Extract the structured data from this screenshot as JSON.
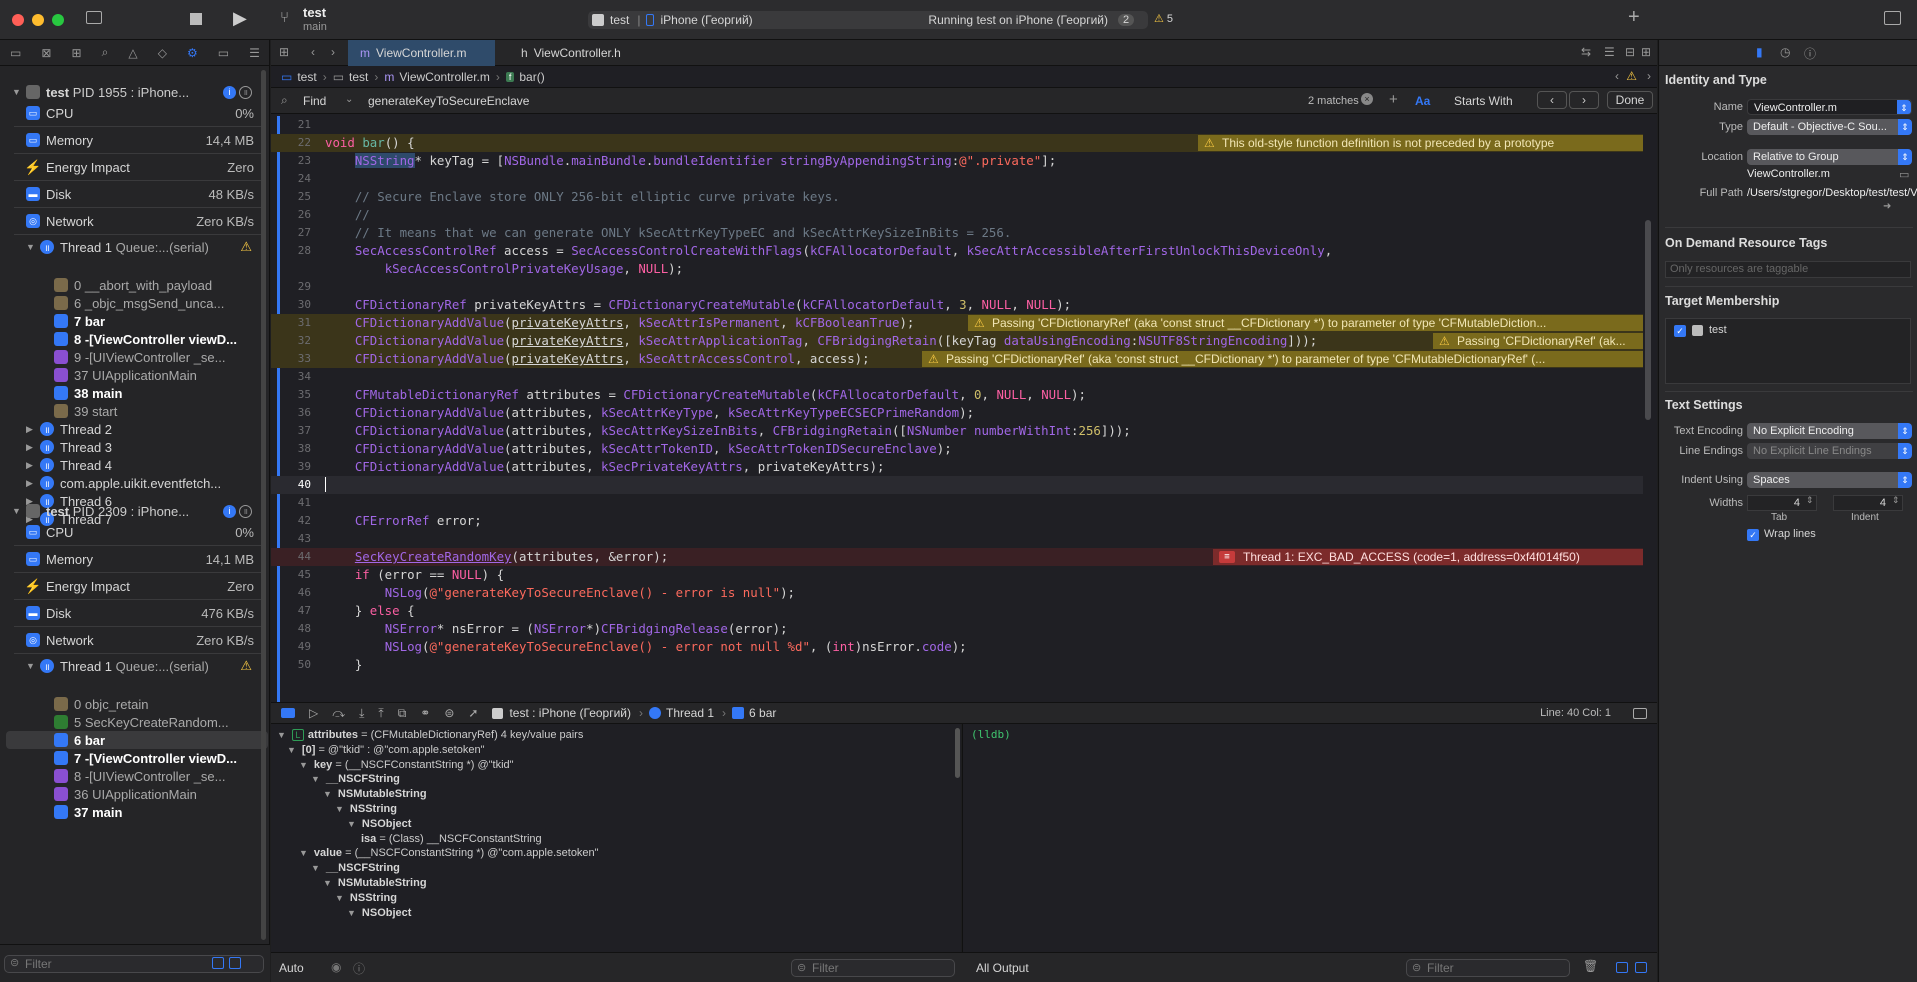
{
  "titlebar": {
    "project": "test",
    "branch": "main",
    "scheme": "test",
    "device": "iPhone (Георгий)",
    "status": "Running test on iPhone (Георгий)",
    "badge": "2",
    "warnings": "5"
  },
  "navigator": {
    "p1": {
      "title": "test",
      "pid": "PID 1955 : iPhone...",
      "cpu_label": "CPU",
      "cpu": "0%",
      "mem_label": "Memory",
      "mem": "14,4 MB",
      "energy_label": "Energy Impact",
      "energy": "Zero",
      "disk_label": "Disk",
      "disk": "48 KB/s",
      "net_label": "Network",
      "net": "Zero KB/s",
      "thread1": "Thread 1",
      "queue": "Queue:...(serial)",
      "frames": [
        "0 __abort_with_payload",
        "6 _objc_msgSend_unca...",
        "7 bar",
        "8 -[ViewController viewD...",
        "9 -[UIViewController _se...",
        "37 UIApplicationMain",
        "38 main",
        "39 start"
      ],
      "threads": [
        "Thread 2",
        "Thread 3",
        "Thread 4",
        "com.apple.uikit.eventfetch...",
        "Thread 6",
        "Thread 7"
      ]
    },
    "p2": {
      "title": "test",
      "pid": "PID 2309 : iPhone...",
      "cpu_label": "CPU",
      "cpu": "0%",
      "mem_label": "Memory",
      "mem": "14,1 MB",
      "energy_label": "Energy Impact",
      "energy": "Zero",
      "disk_label": "Disk",
      "disk": "476 KB/s",
      "net_label": "Network",
      "net": "Zero KB/s",
      "thread1": "Thread 1",
      "queue": "Queue:...(serial)",
      "frames": [
        "0 objc_retain",
        "5 SecKeyCreateRandom...",
        "6 bar",
        "7 -[ViewController viewD...",
        "8 -[UIViewController _se...",
        "36 UIApplicationMain",
        "37 main"
      ]
    },
    "filter_placeholder": "Filter"
  },
  "editor": {
    "tabs": [
      "ViewController.m",
      "ViewController.h"
    ],
    "breadcrumb": [
      "test",
      "test",
      "ViewController.m",
      "bar()"
    ],
    "find": {
      "mode": "Find",
      "query": "generateKeyToSecureEnclave",
      "matches": "2 matches",
      "case": "Aa",
      "option": "Starts With",
      "done": "Done"
    },
    "warnings": {
      "w22": "This old-style function definition is not preceded by a prototype",
      "w31": "Passing 'CFDictionaryRef' (aka 'const struct __CFDictionary *') to parameter of type 'CFMutableDiction...",
      "w32": "Passing 'CFDictionaryRef' (ak...",
      "w33": "Passing 'CFDictionaryRef' (aka 'const struct __CFDictionary *') to parameter of type 'CFMutableDictionaryRef' (...",
      "e44": "Thread 1: EXC_BAD_ACCESS (code=1, address=0xf4f014f50)"
    }
  },
  "debugbar": {
    "process": "test : iPhone (Георгий)",
    "thread": "Thread 1",
    "frame": "6 bar",
    "position": "Line: 40  Col: 1"
  },
  "variables": [
    {
      "t": "attributes",
      "v": "= (CFMutableDictionaryRef) 4 key/value pairs"
    },
    {
      "t": "[0]",
      "v": "= @\"tkid\" : @\"com.apple.setoken\""
    },
    {
      "t": "key",
      "v": "= (__NSCFConstantString *) @\"tkid\""
    },
    {
      "t": "__NSCFString",
      "v": ""
    },
    {
      "t": "NSMutableString",
      "v": ""
    },
    {
      "t": "NSString",
      "v": ""
    },
    {
      "t": "NSObject",
      "v": ""
    },
    {
      "t": "isa",
      "v": "= (Class) __NSCFConstantString"
    },
    {
      "t": "value",
      "v": "= (__NSCFConstantString *) @\"com.apple.setoken\""
    },
    {
      "t": "__NSCFString",
      "v": ""
    },
    {
      "t": "NSMutableString",
      "v": ""
    },
    {
      "t": "NSString",
      "v": ""
    },
    {
      "t": "NSObject",
      "v": ""
    }
  ],
  "console": {
    "prompt": "(lldb)",
    "output_mode": "All Output",
    "auto": "Auto"
  },
  "inspector": {
    "identity_title": "Identity and Type",
    "name_label": "Name",
    "name": "ViewController.m",
    "type_label": "Type",
    "type": "Default - Objective-C Sou...",
    "location_label": "Location",
    "location": "Relative to Group",
    "location_file": "ViewController.m",
    "fullpath_label": "Full Path",
    "fullpath": "/Users/stgregor/Desktop/test/test/ViewController.m",
    "odr_title": "On Demand Resource Tags",
    "odr_placeholder": "Only resources are taggable",
    "target_title": "Target Membership",
    "target": "test",
    "text_title": "Text Settings",
    "enc_label": "Text Encoding",
    "enc": "No Explicit Encoding",
    "le_label": "Line Endings",
    "le": "No Explicit Line Endings",
    "indent_label": "Indent Using",
    "indent": "Spaces",
    "widths_label": "Widths",
    "tab_w": "4",
    "indent_w": "4",
    "tab_label": "Tab",
    "indent_lbl": "Indent",
    "wrap": "Wrap lines"
  },
  "colors": {
    "accent": "#3478f6",
    "warning": "#f7c843",
    "error": "#c53b3b"
  }
}
